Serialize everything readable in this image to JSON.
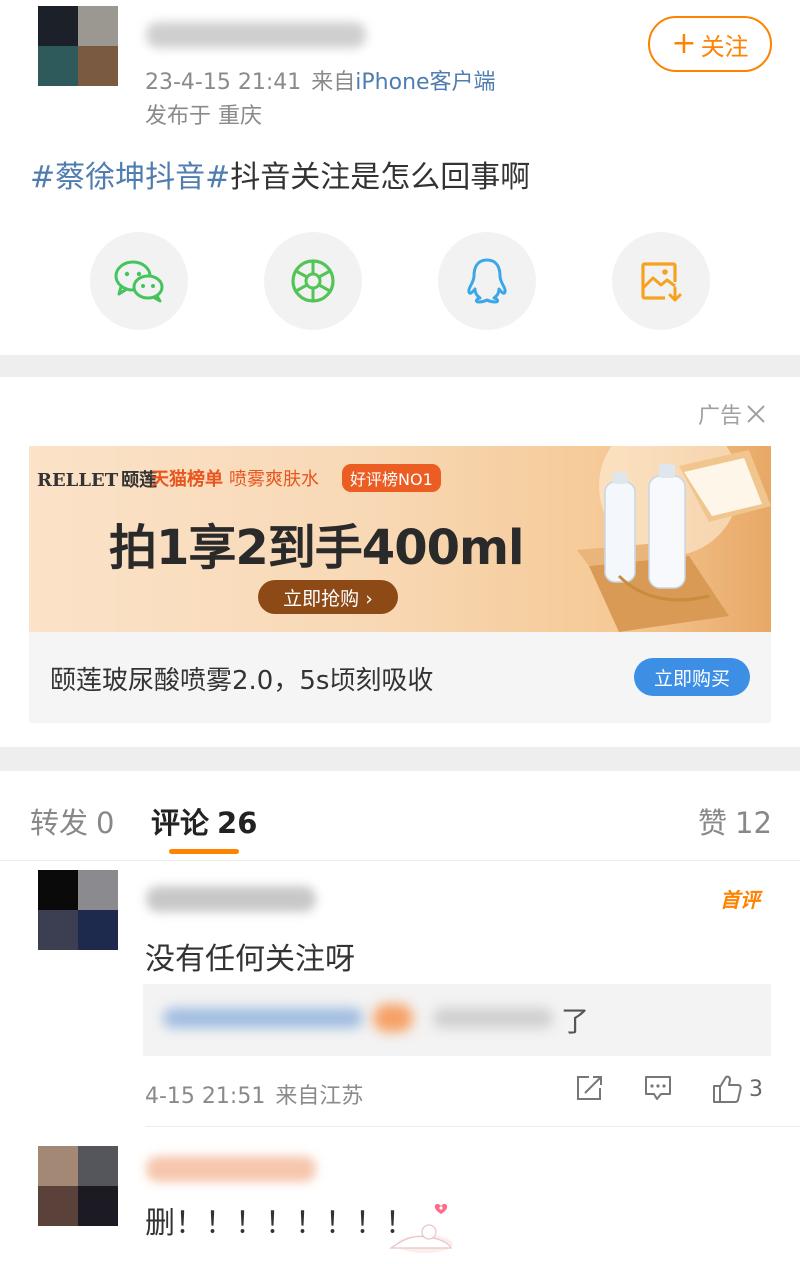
{
  "post": {
    "username_hidden": "",
    "time": "23-4-15 21:41",
    "from_label": "来自",
    "client": "iPhone客户端",
    "location": "发布于 重庆",
    "follow_label": "关注",
    "follow_plus": "+",
    "text": {
      "hashtag": "#蔡徐坤抖音#",
      "body": "抖音关注是怎么回事啊"
    },
    "avatar_colors": [
      "#1c2029",
      "#9b9791",
      "#2e5a5c",
      "#7a5a41"
    ]
  },
  "share": [
    {
      "name": "wechat",
      "icon": "wechat-icon",
      "color": "#45c45d"
    },
    {
      "name": "moments",
      "icon": "moments-icon",
      "color": "#53c456"
    },
    {
      "name": "qq",
      "icon": "qq-icon",
      "color": "#3aa8e8"
    },
    {
      "name": "save-image",
      "icon": "save-image-icon",
      "color": "#f5a31f"
    }
  ],
  "ad": {
    "close_label": "广告",
    "close_icon": "close-icon",
    "banner": {
      "brand_en": "RELLET",
      "brand_cn": "颐莲",
      "tmall": "天猫榜单",
      "tmall_product": "喷雾爽肤水",
      "badge": "好评榜NO1",
      "headline": "拍1享2到手400ml",
      "cta": "立即抢购 ›"
    },
    "caption": "颐莲玻尿酸喷雾2.0，5s顷刻吸收",
    "buy_label": "立即购买"
  },
  "tabs": {
    "repost_label": "转发",
    "repost_count": "0",
    "comment_label": "评论",
    "comment_count": "26",
    "like_label": "赞",
    "like_count": "12",
    "accent": "#ff8200"
  },
  "comments": [
    {
      "badge": "首评",
      "text": "没有任何关注呀",
      "reply_visible_tail": "了",
      "time": "4-15 21:51",
      "from": "来自江苏",
      "like_count": "3",
      "avatar_colors": [
        "#0a0a0a",
        "#8a8a8f",
        "#3b3f51",
        "#1d2a4d"
      ]
    },
    {
      "text": "删！！！！！！！！",
      "avatar_colors": [
        "#a48876",
        "#55565b",
        "#5a4139",
        "#1c1a22"
      ]
    }
  ]
}
